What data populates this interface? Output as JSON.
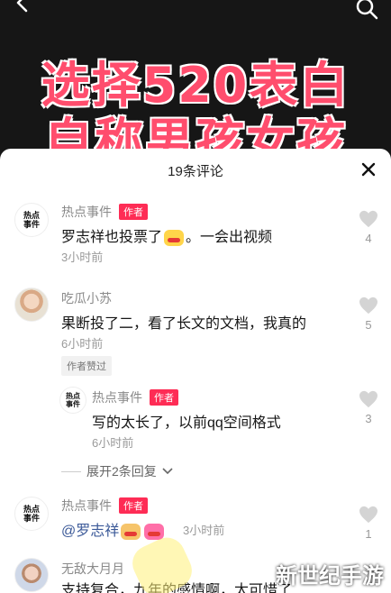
{
  "video": {
    "headline_line1": "选择520表白",
    "headline_line2": "自称男孩女孩"
  },
  "sheet": {
    "title": "19条评论"
  },
  "comments": [
    {
      "avatar_text": "热点\n事件",
      "name": "热点事件",
      "badge": "作者",
      "text_before": "罗志祥也投票了",
      "text_after": "。一会出视频",
      "time": "3小时前",
      "likes": "4"
    },
    {
      "name": "吃瓜小苏",
      "text": "果断投了二，看了长文的文档，我真的",
      "time": "6小时前",
      "liked_tag": "作者赞过",
      "likes": "5"
    },
    {
      "avatar_text": "热点\n事件",
      "name": "热点事件",
      "badge": "作者",
      "text": "写的太长了，以前qq空间格式",
      "time": "6小时前",
      "likes": "3"
    },
    {
      "avatar_text": "热点\n事件",
      "name": "热点事件",
      "badge": "作者",
      "mention": "@罗志祥",
      "time": "3小时前",
      "likes": "1"
    },
    {
      "name": "无敌大月月",
      "text": "支持复合，九年的感情啊，太可惜了"
    }
  ],
  "expand_replies": "展开2条回复",
  "watermark": "新世纪手游"
}
